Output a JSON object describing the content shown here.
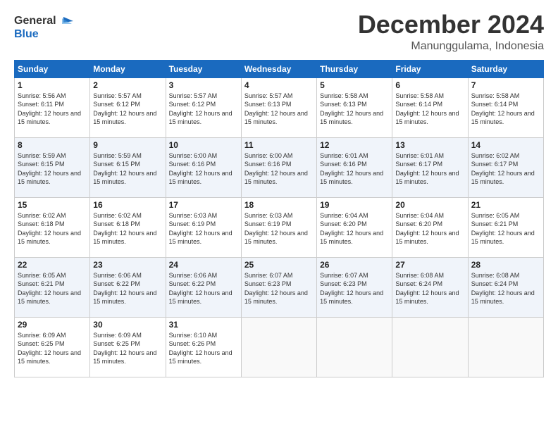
{
  "logo": {
    "line1": "General",
    "line2": "Blue"
  },
  "header": {
    "month": "December 2024",
    "location": "Manunggulama, Indonesia"
  },
  "weekdays": [
    "Sunday",
    "Monday",
    "Tuesday",
    "Wednesday",
    "Thursday",
    "Friday",
    "Saturday"
  ],
  "weeks": [
    [
      {
        "day": "1",
        "sunrise": "5:56 AM",
        "sunset": "6:11 PM",
        "daylight": "12 hours and 15 minutes."
      },
      {
        "day": "2",
        "sunrise": "5:57 AM",
        "sunset": "6:12 PM",
        "daylight": "12 hours and 15 minutes."
      },
      {
        "day": "3",
        "sunrise": "5:57 AM",
        "sunset": "6:12 PM",
        "daylight": "12 hours and 15 minutes."
      },
      {
        "day": "4",
        "sunrise": "5:57 AM",
        "sunset": "6:13 PM",
        "daylight": "12 hours and 15 minutes."
      },
      {
        "day": "5",
        "sunrise": "5:58 AM",
        "sunset": "6:13 PM",
        "daylight": "12 hours and 15 minutes."
      },
      {
        "day": "6",
        "sunrise": "5:58 AM",
        "sunset": "6:14 PM",
        "daylight": "12 hours and 15 minutes."
      },
      {
        "day": "7",
        "sunrise": "5:58 AM",
        "sunset": "6:14 PM",
        "daylight": "12 hours and 15 minutes."
      }
    ],
    [
      {
        "day": "8",
        "sunrise": "5:59 AM",
        "sunset": "6:15 PM",
        "daylight": "12 hours and 15 minutes."
      },
      {
        "day": "9",
        "sunrise": "5:59 AM",
        "sunset": "6:15 PM",
        "daylight": "12 hours and 15 minutes."
      },
      {
        "day": "10",
        "sunrise": "6:00 AM",
        "sunset": "6:16 PM",
        "daylight": "12 hours and 15 minutes."
      },
      {
        "day": "11",
        "sunrise": "6:00 AM",
        "sunset": "6:16 PM",
        "daylight": "12 hours and 15 minutes."
      },
      {
        "day": "12",
        "sunrise": "6:01 AM",
        "sunset": "6:16 PM",
        "daylight": "12 hours and 15 minutes."
      },
      {
        "day": "13",
        "sunrise": "6:01 AM",
        "sunset": "6:17 PM",
        "daylight": "12 hours and 15 minutes."
      },
      {
        "day": "14",
        "sunrise": "6:02 AM",
        "sunset": "6:17 PM",
        "daylight": "12 hours and 15 minutes."
      }
    ],
    [
      {
        "day": "15",
        "sunrise": "6:02 AM",
        "sunset": "6:18 PM",
        "daylight": "12 hours and 15 minutes."
      },
      {
        "day": "16",
        "sunrise": "6:02 AM",
        "sunset": "6:18 PM",
        "daylight": "12 hours and 15 minutes."
      },
      {
        "day": "17",
        "sunrise": "6:03 AM",
        "sunset": "6:19 PM",
        "daylight": "12 hours and 15 minutes."
      },
      {
        "day": "18",
        "sunrise": "6:03 AM",
        "sunset": "6:19 PM",
        "daylight": "12 hours and 15 minutes."
      },
      {
        "day": "19",
        "sunrise": "6:04 AM",
        "sunset": "6:20 PM",
        "daylight": "12 hours and 15 minutes."
      },
      {
        "day": "20",
        "sunrise": "6:04 AM",
        "sunset": "6:20 PM",
        "daylight": "12 hours and 15 minutes."
      },
      {
        "day": "21",
        "sunrise": "6:05 AM",
        "sunset": "6:21 PM",
        "daylight": "12 hours and 15 minutes."
      }
    ],
    [
      {
        "day": "22",
        "sunrise": "6:05 AM",
        "sunset": "6:21 PM",
        "daylight": "12 hours and 15 minutes."
      },
      {
        "day": "23",
        "sunrise": "6:06 AM",
        "sunset": "6:22 PM",
        "daylight": "12 hours and 15 minutes."
      },
      {
        "day": "24",
        "sunrise": "6:06 AM",
        "sunset": "6:22 PM",
        "daylight": "12 hours and 15 minutes."
      },
      {
        "day": "25",
        "sunrise": "6:07 AM",
        "sunset": "6:23 PM",
        "daylight": "12 hours and 15 minutes."
      },
      {
        "day": "26",
        "sunrise": "6:07 AM",
        "sunset": "6:23 PM",
        "daylight": "12 hours and 15 minutes."
      },
      {
        "day": "27",
        "sunrise": "6:08 AM",
        "sunset": "6:24 PM",
        "daylight": "12 hours and 15 minutes."
      },
      {
        "day": "28",
        "sunrise": "6:08 AM",
        "sunset": "6:24 PM",
        "daylight": "12 hours and 15 minutes."
      }
    ],
    [
      {
        "day": "29",
        "sunrise": "6:09 AM",
        "sunset": "6:25 PM",
        "daylight": "12 hours and 15 minutes."
      },
      {
        "day": "30",
        "sunrise": "6:09 AM",
        "sunset": "6:25 PM",
        "daylight": "12 hours and 15 minutes."
      },
      {
        "day": "31",
        "sunrise": "6:10 AM",
        "sunset": "6:26 PM",
        "daylight": "12 hours and 15 minutes."
      },
      null,
      null,
      null,
      null
    ]
  ],
  "labels": {
    "sunrise": "Sunrise:",
    "sunset": "Sunset:",
    "daylight": "Daylight:"
  }
}
